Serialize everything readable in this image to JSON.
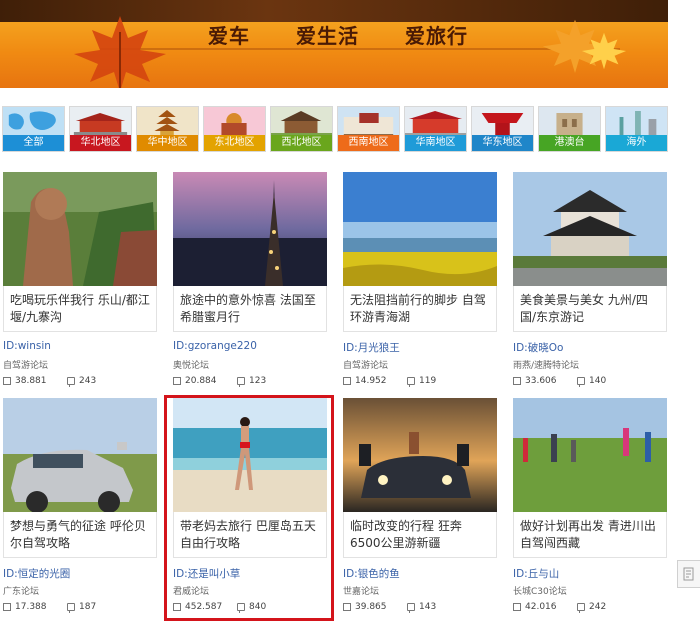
{
  "banner": {
    "headline": "",
    "slogans": [
      "爱车",
      "爱生活",
      "爱旅行"
    ]
  },
  "regions": [
    {
      "label": "全部",
      "color": "#1d8fd6"
    },
    {
      "label": "华北地区",
      "color": "#c8171f"
    },
    {
      "label": "华中地区",
      "color": "#e08b00"
    },
    {
      "label": "东北地区",
      "color": "#e3a300"
    },
    {
      "label": "西北地区",
      "color": "#6aa61c"
    },
    {
      "label": "西南地区",
      "color": "#ee6b1a"
    },
    {
      "label": "华南地区",
      "color": "#1f9bd8"
    },
    {
      "label": "华东地区",
      "color": "#1f86c9"
    },
    {
      "label": "港澳台",
      "color": "#47a524"
    },
    {
      "label": "海外",
      "color": "#1aa8d6"
    }
  ],
  "cards": [
    {
      "title": "吃喝玩乐伴我行 乐山/都江堰/九寨沟",
      "author": "ID:winsin",
      "forum": "自驾游论坛",
      "views": "38.881",
      "replies": "243",
      "photo": "buddha-cliff"
    },
    {
      "title": "旅途中的意外惊喜 法国至希腊蜜月行",
      "author": "ID:gzorange220",
      "forum": "奥悦论坛",
      "views": "20.884",
      "replies": "123",
      "photo": "eiffel-dusk"
    },
    {
      "title": "无法阻挡前行的脚步 自驾环游青海湖",
      "author": "ID:月光狼王",
      "forum": "自驾游论坛",
      "views": "14.952",
      "replies": "119",
      "photo": "rapeseed-lake"
    },
    {
      "title": "美食美景与美女 九州/四国/东京游记",
      "author": "ID:破晓Oo",
      "forum": "雨燕/速腾特论坛",
      "views": "33.606",
      "replies": "140",
      "photo": "japanese-castle"
    },
    {
      "title": "梦想与勇气的征途 呼伦贝尔自驾攻略",
      "author": "ID:恒定的光圈",
      "forum": "广东论坛",
      "views": "17.388",
      "replies": "187",
      "photo": "suv-grassland"
    },
    {
      "title": "带老妈去旅行 巴厘岛五天自由行攻略",
      "author": "ID:还是叫小草",
      "forum": "君威论坛",
      "views": "452.587",
      "replies": "840",
      "photo": "beach-woman"
    },
    {
      "title": "临时改变的行程 狂奔6500公里游新疆",
      "author": "ID:银色的鱼",
      "forum": "世嘉论坛",
      "views": "39.865",
      "replies": "143",
      "photo": "car-night"
    },
    {
      "title": "做好计划再出发 青进川出自驾闯西藏",
      "author": "ID:丘与山",
      "forum": "长城C30论坛",
      "views": "42.016",
      "replies": "242",
      "photo": "jumping-group"
    }
  ]
}
